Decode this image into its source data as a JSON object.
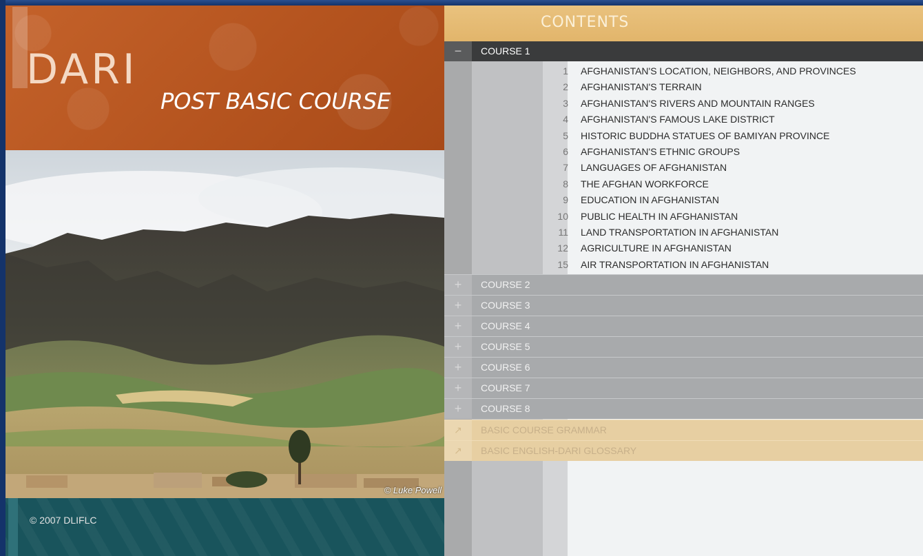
{
  "brand": {
    "title": "DARI",
    "subtitle": "POST BASIC COURSE",
    "photo_credit": "© Luke Powell",
    "copyright": "© 2007 DLIFLC"
  },
  "contents": {
    "title": "CONTENTS",
    "expanded_course": {
      "toggle": "−",
      "label": "COURSE 1",
      "lessons": [
        {
          "num": "1",
          "title": "AFGHANISTAN'S LOCATION, NEIGHBORS, AND PROVINCES"
        },
        {
          "num": "2",
          "title": "AFGHANISTAN'S TERRAIN"
        },
        {
          "num": "3",
          "title": "AFGHANISTAN'S RIVERS AND MOUNTAIN RANGES"
        },
        {
          "num": "4",
          "title": "AFGHANISTAN'S FAMOUS LAKE DISTRICT"
        },
        {
          "num": "5",
          "title": "HISTORIC BUDDHA STATUES OF BAMIYAN PROVINCE"
        },
        {
          "num": "6",
          "title": "AFGHANISTAN'S ETHNIC GROUPS"
        },
        {
          "num": "7",
          "title": "LANGUAGES OF AFGHANISTAN"
        },
        {
          "num": "8",
          "title": "THE AFGHAN WORKFORCE"
        },
        {
          "num": "9",
          "title": "EDUCATION IN AFGHANISTAN"
        },
        {
          "num": "10",
          "title": "PUBLIC HEALTH IN AFGHANISTAN"
        },
        {
          "num": "11",
          "title": "LAND TRANSPORTATION IN AFGHANISTAN"
        },
        {
          "num": "12",
          "title": "AGRICULTURE IN AFGHANISTAN"
        },
        {
          "num": "15",
          "title": "AIR TRANSPORTATION IN AFGHANISTAN"
        }
      ]
    },
    "collapsed_courses": [
      {
        "toggle": "+",
        "label": "COURSE 2"
      },
      {
        "toggle": "+",
        "label": "COURSE 3"
      },
      {
        "toggle": "+",
        "label": "COURSE 4"
      },
      {
        "toggle": "+",
        "label": "COURSE 5"
      },
      {
        "toggle": "+",
        "label": "COURSE 6"
      },
      {
        "toggle": "+",
        "label": "COURSE 7"
      },
      {
        "toggle": "+",
        "label": "COURSE 8"
      }
    ],
    "resources": [
      {
        "icon": "external-link-icon",
        "glyph": "↗",
        "label": "BASIC COURSE GRAMMAR"
      },
      {
        "icon": "external-link-icon",
        "glyph": "↗",
        "label": "BASIC ENGLISH-DARI GLOSSARY"
      }
    ]
  },
  "colors": {
    "brand_orange": "#b5541f",
    "footer_teal": "#19545c",
    "contents_gold": "#e5b96f",
    "active_row": "#3a3b3c",
    "collapsed_row": "#a8aaac",
    "resource_row": "#e7cfa2"
  }
}
